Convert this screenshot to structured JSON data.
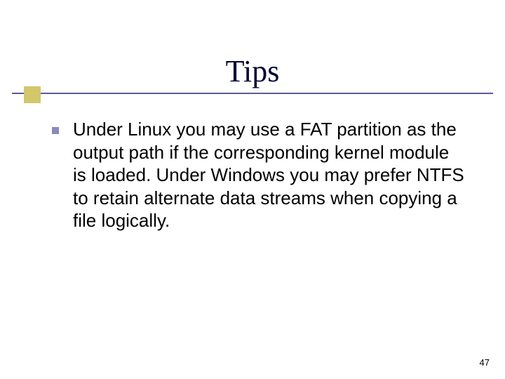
{
  "slide": {
    "title": "Tips",
    "bullets": [
      "Under Linux you may use a FAT partition as the output path if the corresponding kernel module is loaded. Under Windows you may prefer NTFS to retain alternate data streams when copying a file logically."
    ],
    "page_number": "47"
  }
}
